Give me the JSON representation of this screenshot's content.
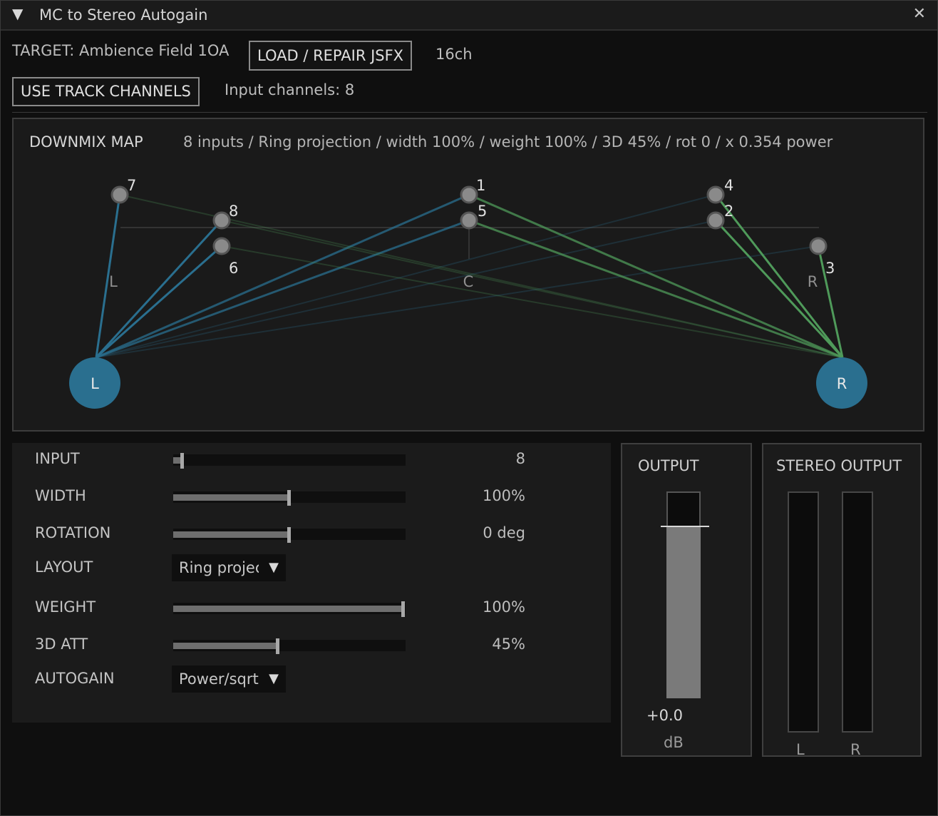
{
  "window": {
    "title": "MC to Stereo Autogain",
    "collapse_icon": "▼",
    "close_icon": "✕"
  },
  "header": {
    "target": "TARGET: Ambience Field 1OA",
    "load_button": "LOAD / REPAIR JSFX",
    "channels": "16ch",
    "use_track_button": "USE TRACK CHANNELS",
    "input_channels": "Input channels: 8"
  },
  "downmix_map": {
    "title": "DOWNMIX MAP",
    "summary": "8 inputs / Ring projection / width 100% / weight 100% / 3D 45% / rot 0 / x 0.354 power",
    "axis_labels": {
      "left": "L",
      "center": "C",
      "right": "R"
    },
    "outputs": {
      "left": "L",
      "right": "R"
    },
    "colors": {
      "left": "#2a6f8f",
      "right": "#4f9a5a",
      "node": "#8a8a8a"
    },
    "inputs": [
      {
        "id": "1",
        "label": "1"
      },
      {
        "id": "2",
        "label": "2"
      },
      {
        "id": "3",
        "label": "3"
      },
      {
        "id": "4",
        "label": "4"
      },
      {
        "id": "5",
        "label": "5"
      },
      {
        "id": "6",
        "label": "6"
      },
      {
        "id": "7",
        "label": "7"
      },
      {
        "id": "8",
        "label": "8"
      }
    ]
  },
  "controls": {
    "input": {
      "label": "INPUT",
      "value": "8",
      "fraction": 0.04
    },
    "width": {
      "label": "WIDTH",
      "value": "100%",
      "fraction": 0.5
    },
    "rotation": {
      "label": "ROTATION",
      "value": "0 deg",
      "fraction": 0.5
    },
    "layout": {
      "label": "LAYOUT",
      "selected": "Ring projection",
      "arrow": "▼"
    },
    "weight": {
      "label": "WEIGHT",
      "value": "100%",
      "fraction": 0.99
    },
    "att3d": {
      "label": "3D ATT",
      "value": "45%",
      "fraction": 0.45
    },
    "autogain": {
      "label": "AUTOGAIN",
      "selected": "Power/sqrt",
      "arrow": "▼"
    }
  },
  "output": {
    "title": "OUTPUT",
    "value": "+0.0",
    "unit": "dB",
    "level": 0.83
  },
  "stereo_output": {
    "title": "STEREO OUTPUT",
    "left_label": "L",
    "right_label": "R"
  }
}
